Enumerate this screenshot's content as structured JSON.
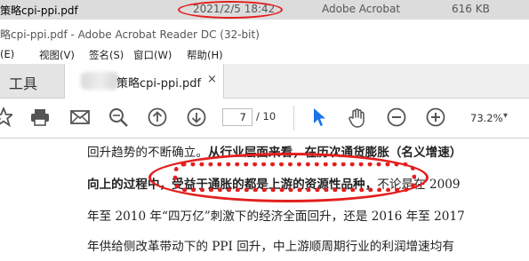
{
  "file_row": {
    "name": "策略cpi-ppi.pdf",
    "date": "2021/2/5 18:42",
    "app": "Adobe Acrobat",
    "size": "616 KB"
  },
  "window": {
    "title": "略cpi-ppi.pdf - Adobe Acrobat Reader DC (32-bit)"
  },
  "menu": {
    "items": [
      "(E)",
      "视图(V)",
      "签名(S)",
      "窗口(W)",
      "帮助(H)"
    ]
  },
  "tabs": {
    "tools": "工具",
    "document": "策略cpi-ppi.pdf",
    "close": "×"
  },
  "toolbar": {
    "icons": [
      "star-icon",
      "print-icon",
      "email-icon",
      "search-zoom-icon",
      "page-up-icon",
      "page-down-icon",
      "select-pointer-icon",
      "hand-icon",
      "zoom-out-icon",
      "zoom-in-icon"
    ],
    "page_current": "7",
    "page_total": "/ 10",
    "zoom": "73.2%",
    "zoom_caret": "▾"
  },
  "document": {
    "lines": [
      {
        "a": "回升趋势的不断确立。",
        "b": "从行业层面来看，在历次通货膨胀（名义增速）"
      },
      {
        "a": "向上的过程中，受益于通胀的都是上游的资源性品种，",
        "b": "不论是在 2009"
      },
      {
        "a": "年至 2010 年“四万亿”刺激下的经济全面回升，还是 2016 年至 2017"
      },
      {
        "a": "年供给侧改革带动下的 PPI 回升，中上游顺周期行业的利润增速均有"
      }
    ]
  },
  "colors": {
    "annotation_red": "#e41e1e",
    "accent_blue": "#1a73e8"
  }
}
